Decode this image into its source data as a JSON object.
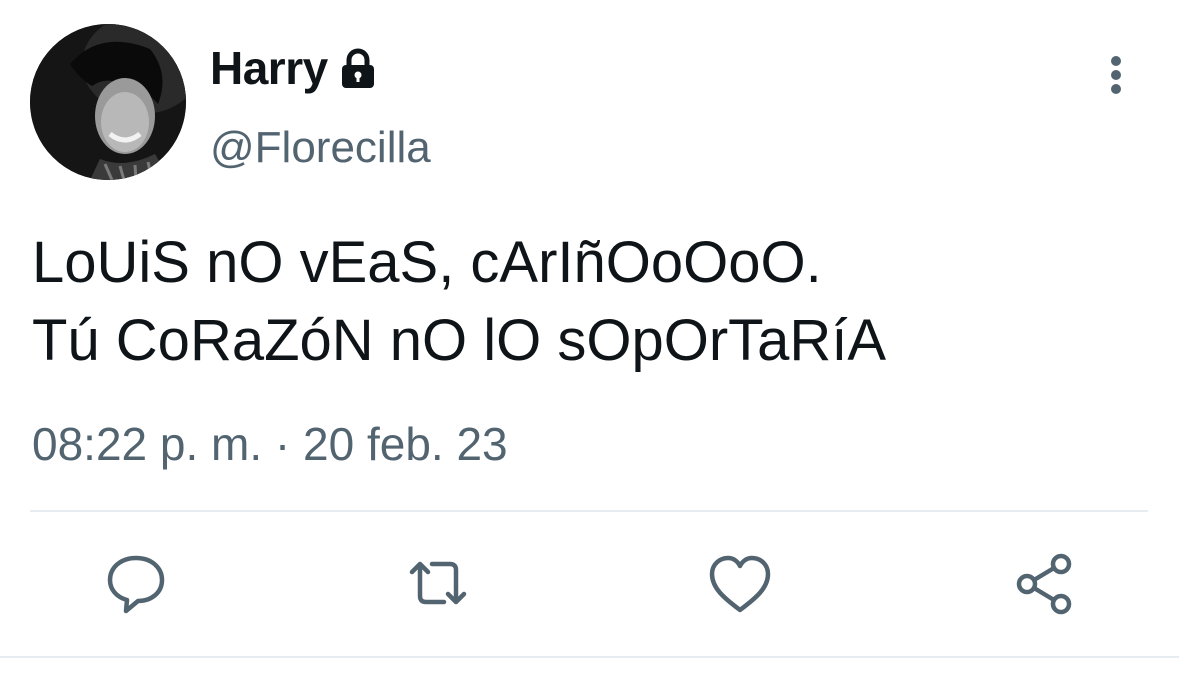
{
  "author": {
    "display_name": "Harry",
    "handle": "@Florecilla",
    "protected_icon": "lock-icon",
    "avatar_icon": "profile-photo"
  },
  "tweet": {
    "lines": [
      "LoUiS nO vEaS, cArIñOoOoO.",
      "Tú CoRaZóN nO lO sOpOrTaRíA"
    ],
    "timestamp": "08:22 p. m. · 20 feb. 23"
  },
  "menu": {
    "icon": "more-vertical-icon"
  },
  "actions": [
    {
      "name": "reply",
      "icon": "reply-icon"
    },
    {
      "name": "retweet",
      "icon": "retweet-icon"
    },
    {
      "name": "like",
      "icon": "heart-icon"
    },
    {
      "name": "share",
      "icon": "share-icon"
    }
  ],
  "colors": {
    "text_primary": "#0f1419",
    "text_secondary": "#536471",
    "icon_gray": "#536471",
    "divider": "#e6ecf0"
  }
}
